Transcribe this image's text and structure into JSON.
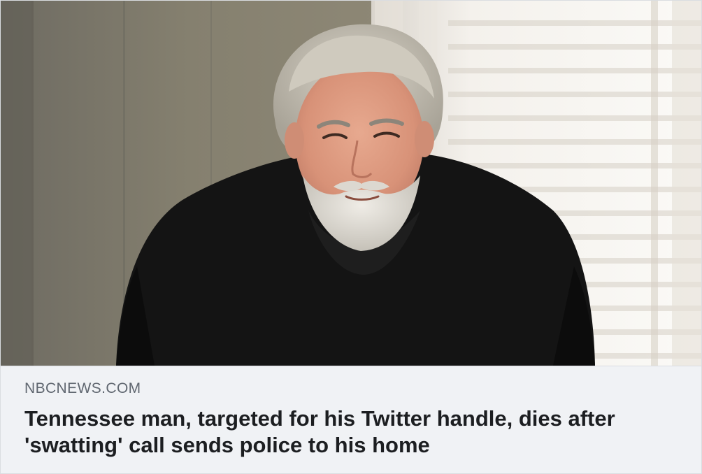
{
  "link_preview": {
    "domain": "NBCNEWS.COM",
    "headline": "Tennessee man, targeted for his Twitter handle, dies after 'swatting' call sends police to his home"
  },
  "colors": {
    "card_background": "#f0f2f5",
    "domain_text": "#606770",
    "headline_text": "#1c1e21",
    "border": "#dadde1"
  }
}
